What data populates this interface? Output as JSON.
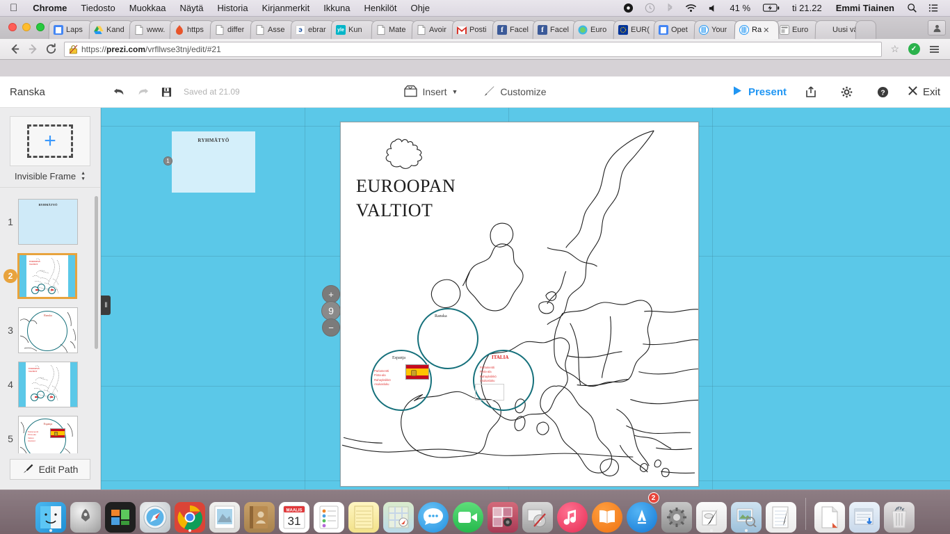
{
  "menubar": {
    "apple": "",
    "items": [
      {
        "label": "Chrome",
        "bold": true
      },
      {
        "label": "Tiedosto",
        "bold": false
      },
      {
        "label": "Muokkaa",
        "bold": false
      },
      {
        "label": "Näytä",
        "bold": false
      },
      {
        "label": "Historia",
        "bold": false
      },
      {
        "label": "Kirjanmerkit",
        "bold": false
      },
      {
        "label": "Ikkuna",
        "bold": false
      },
      {
        "label": "Henkilöt",
        "bold": false
      },
      {
        "label": "Ohje",
        "bold": false
      }
    ],
    "battery": "41 %",
    "clock": "ti 21.22",
    "user": "Emmi Tiainen"
  },
  "browser": {
    "tabs": [
      {
        "title": "Laps",
        "favicon": "docs-icon",
        "active": false
      },
      {
        "title": "Kand",
        "favicon": "drive-icon",
        "active": false
      },
      {
        "title": "www.",
        "favicon": "page-icon",
        "active": false
      },
      {
        "title": "https",
        "favicon": "flame-icon",
        "active": false
      },
      {
        "title": "differ",
        "favicon": "page-icon",
        "active": false
      },
      {
        "title": "Asse",
        "favicon": "page-icon",
        "active": false
      },
      {
        "title": "ebrar",
        "favicon": "ebrary-icon",
        "active": false
      },
      {
        "title": "Kun",
        "favicon": "yle-icon",
        "active": false
      },
      {
        "title": "Mate",
        "favicon": "page-icon",
        "active": false
      },
      {
        "title": "Avoir",
        "favicon": "page-icon",
        "active": false
      },
      {
        "title": "Posti",
        "favicon": "gmail-icon",
        "active": false
      },
      {
        "title": "Facel",
        "favicon": "facebook-icon",
        "active": false
      },
      {
        "title": "Facel",
        "favicon": "facebook-icon",
        "active": false
      },
      {
        "title": "Euro",
        "favicon": "globe-icon",
        "active": false
      },
      {
        "title": "EUR(",
        "favicon": "eu-icon",
        "active": false
      },
      {
        "title": "Opet",
        "favicon": "docs-icon",
        "active": false
      },
      {
        "title": "Your",
        "favicon": "prezi-icon",
        "active": false
      },
      {
        "title": "Ra",
        "favicon": "prezi-icon",
        "active": true
      },
      {
        "title": "Euro",
        "favicon": "window-icon",
        "active": false
      },
      {
        "title": "Uusi väl",
        "favicon": "none",
        "active": false
      }
    ],
    "new_tab_label": "",
    "url_prefix": "https://",
    "url_domain": "prezi.com",
    "url_rest": "/vrfllwse3tnj/edit/#21"
  },
  "prezi": {
    "title": "Ranska",
    "saved_text": "Saved at 21.09",
    "insert_label": "Insert",
    "customize_label": "Customize",
    "present_label": "Present",
    "exit_label": "Exit",
    "frame_type": "Invisible Frame",
    "edit_path_label": "Edit Path",
    "thumbnails": [
      {
        "num": "1",
        "kind": "title-slide",
        "selected": false
      },
      {
        "num": "2",
        "kind": "map-slide",
        "selected": true
      },
      {
        "num": "3",
        "kind": "circle-ranska",
        "selected": false
      },
      {
        "num": "4",
        "kind": "map-slide",
        "selected": false
      },
      {
        "num": "5",
        "kind": "circle-espanja",
        "selected": false
      }
    ],
    "zoom_controls": {
      "zoom_in": "+",
      "home": "9",
      "zoom_out": "−"
    },
    "canvas": {
      "slide1_title": "RYHMÄTYÖ",
      "slide1_path_number": "1",
      "map_title_line1": "EUROOPAN",
      "map_title_line2": "VALTIOT",
      "circles": [
        {
          "label": "Ranska",
          "style": "plain"
        },
        {
          "label": "Espanja",
          "style": "plain",
          "list": [
            "Parlamentti",
            "Pinta-ala",
            "Rahayksikkö",
            "Asukasluku"
          ],
          "flag": "spain"
        },
        {
          "label": "ITALIA",
          "style": "red",
          "list": [
            "Parlamentti",
            "Pinta-ala",
            "Rahayksikkö",
            "Asukasluku"
          ]
        }
      ]
    }
  },
  "dock": {
    "items": [
      {
        "name": "finder",
        "glyph": "",
        "running": true
      },
      {
        "name": "launchpad",
        "glyph": "",
        "running": false
      },
      {
        "name": "mission-control",
        "glyph": "",
        "running": false
      },
      {
        "name": "safari",
        "glyph": "",
        "running": false
      },
      {
        "name": "chrome",
        "glyph": "",
        "running": true
      },
      {
        "name": "mail",
        "glyph": "",
        "running": false
      },
      {
        "name": "contacts",
        "glyph": "",
        "running": false
      },
      {
        "name": "calendar",
        "glyph": "31",
        "badge_top": "MAALIS",
        "running": false
      },
      {
        "name": "reminders",
        "glyph": "",
        "running": false
      },
      {
        "name": "notes",
        "glyph": "",
        "running": false
      },
      {
        "name": "maps",
        "glyph": "",
        "running": false
      },
      {
        "name": "messages",
        "glyph": "",
        "running": false
      },
      {
        "name": "facetime",
        "glyph": "",
        "running": false
      },
      {
        "name": "photo-booth",
        "glyph": "",
        "running": false
      },
      {
        "name": "dvd-player",
        "glyph": "",
        "running": false
      },
      {
        "name": "itunes",
        "glyph": "",
        "running": false
      },
      {
        "name": "ibooks",
        "glyph": "",
        "running": false
      },
      {
        "name": "app-store",
        "glyph": "",
        "badge": "2",
        "running": false
      },
      {
        "name": "system-preferences",
        "glyph": "",
        "running": false
      },
      {
        "name": "textedit",
        "glyph": "",
        "running": true
      },
      {
        "name": "preview",
        "glyph": "",
        "running": true
      },
      {
        "name": "notebook",
        "glyph": "",
        "running": false
      },
      {
        "name": "documents-stack",
        "glyph": "",
        "running": false
      },
      {
        "name": "downloads-stack",
        "glyph": "",
        "running": false
      },
      {
        "name": "trash",
        "glyph": "",
        "running": false
      }
    ]
  }
}
